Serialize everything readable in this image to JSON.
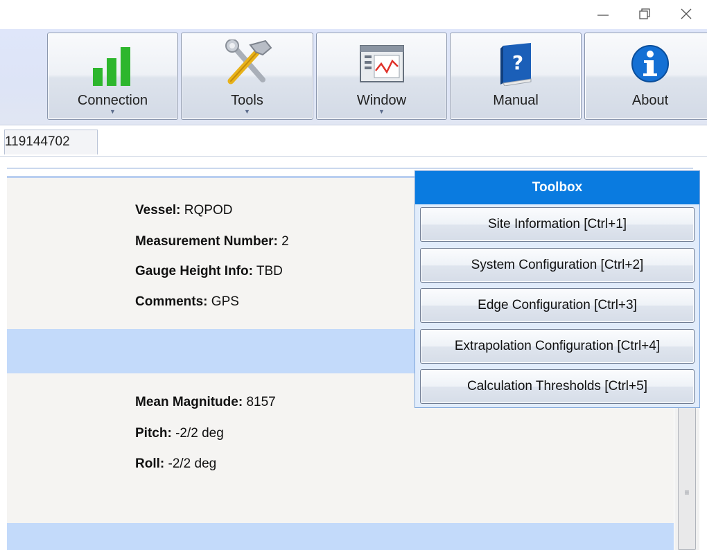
{
  "window": {
    "minimize_glyph": "—",
    "restore_glyph": "❐",
    "close_glyph": "✕"
  },
  "ribbon": {
    "buttons": [
      {
        "label": "Connection",
        "icon": "signal-bars-icon",
        "has_dropdown": true
      },
      {
        "label": "Tools",
        "icon": "hammer-wrench-icon",
        "has_dropdown": true
      },
      {
        "label": "Window",
        "icon": "window-chart-icon",
        "has_dropdown": true
      },
      {
        "label": "Manual",
        "icon": "help-book-icon",
        "has_dropdown": false
      },
      {
        "label": "About",
        "icon": "info-icon",
        "has_dropdown": false
      }
    ],
    "dropdown_glyph": "▼"
  },
  "tabs": [
    {
      "label": "119144702"
    }
  ],
  "site_info": {
    "vessel_label": "Vessel:",
    "vessel_value": "RQPOD",
    "measurement_label": "Measurement Number:",
    "measurement_value": "2",
    "gauge_label": "Gauge Height Info:",
    "gauge_value": "TBD",
    "comments_label": "Comments:",
    "comments_value": "GPS"
  },
  "compass_info": {
    "magnitude_label": "Mean Magnitude:",
    "magnitude_value": "8157",
    "pitch_label": "Pitch:",
    "pitch_value": "-2/2 deg",
    "roll_label": "Roll:",
    "roll_value": "-2/2 deg"
  },
  "toolbox": {
    "title": "Toolbox",
    "items": [
      {
        "label": "Site Information [Ctrl+1]"
      },
      {
        "label": "System Configuration [Ctrl+2]"
      },
      {
        "label": "Edge Configuration [Ctrl+3]"
      },
      {
        "label": "Extrapolation Configuration [Ctrl+4]"
      },
      {
        "label": "Calculation Thresholds [Ctrl+5]"
      }
    ]
  },
  "colors": {
    "toolbox_header": "#0a7be0",
    "band": "#c3dafa",
    "signal_green": "#2db62d"
  },
  "scrollbar": {
    "grip_glyph": "≡"
  }
}
